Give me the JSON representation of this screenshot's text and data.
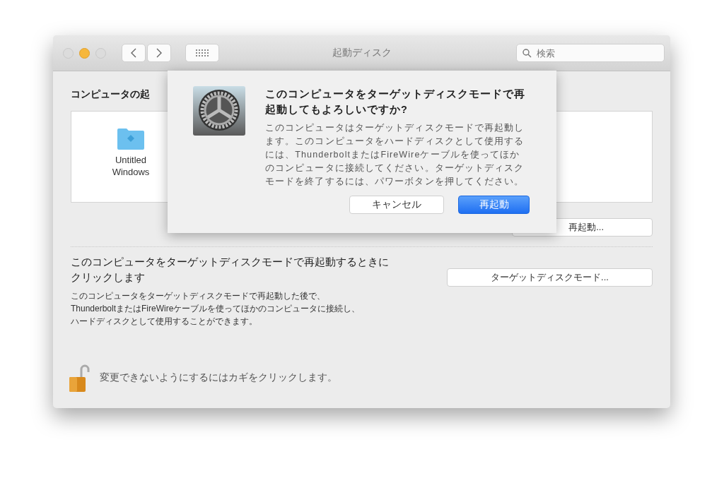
{
  "window": {
    "title": "起動ディスク",
    "search": {
      "placeholder": "検索"
    }
  },
  "startup": {
    "heading": "コンピュータの起",
    "disks": [
      {
        "name": "Untitled\nWindows",
        "selected": false
      }
    ],
    "restart_button": "再起動..."
  },
  "target_mode": {
    "title": "このコンピュータをターゲットディスクモードで再起動するときにクリックします",
    "description_lines": [
      "このコンピュータをターゲットディスクモードで再起動した後で、",
      "ThunderboltまたはFireWireケーブルを使ってほかのコンピュータに接続し、",
      "ハードディスクとして使用することができます。"
    ],
    "button": "ターゲットディスクモード..."
  },
  "lock": {
    "locked": false,
    "text": "変更できないようにするにはカギをクリックします。"
  },
  "dialog": {
    "title": "このコンピュータをターゲットディスクモードで再起動してもよろしいですか?",
    "message": "このコンピュータはターゲットディスクモードで再起動します。このコンピュータをハードディスクとして使用するには、ThunderboltまたはFireWireケーブルを使ってほかのコンピュータに接続してください。ターゲットディスクモードを終了するには、パワーボタンを押してください。",
    "buttons": [
      {
        "label": "キャンセル",
        "kind": "secondary"
      },
      {
        "label": "再起動",
        "kind": "default"
      }
    ]
  }
}
